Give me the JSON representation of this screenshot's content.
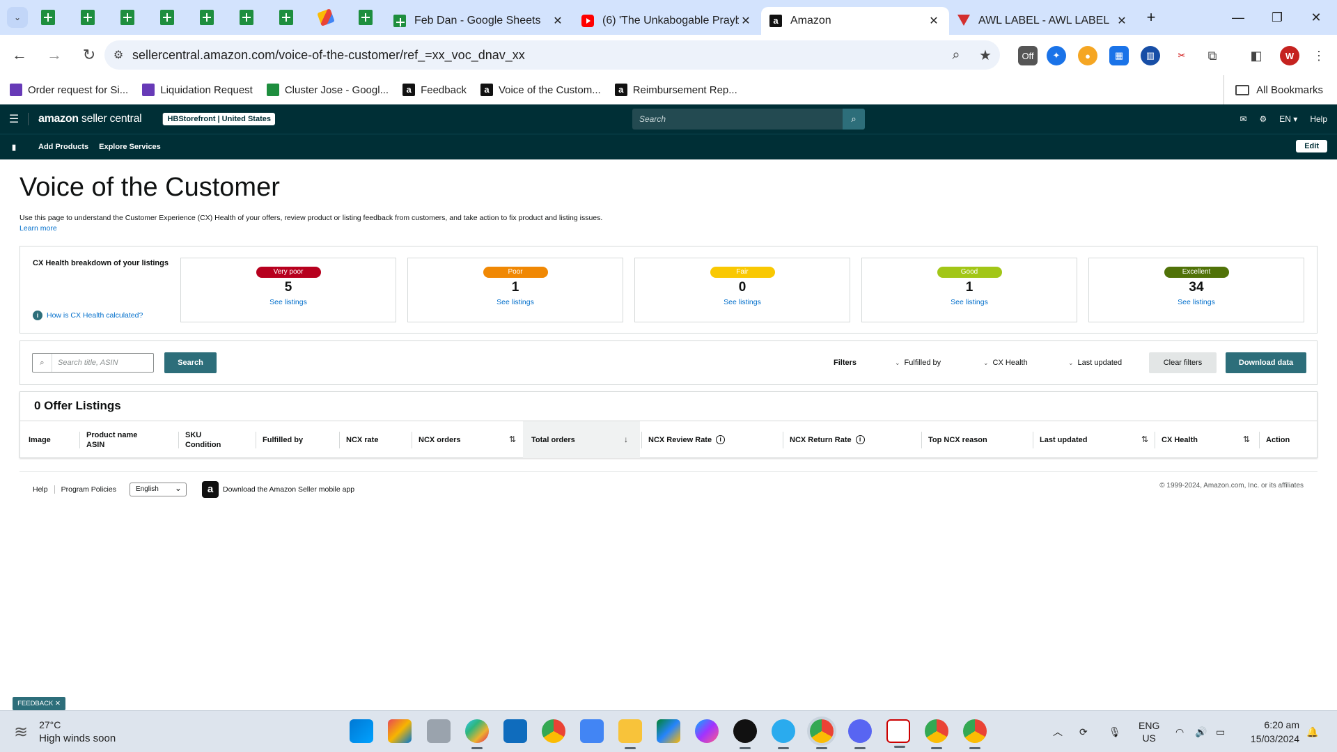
{
  "browser": {
    "tabs": [
      {
        "title": "Feb Dan - Google Sheets",
        "icon": "sheets-icon"
      },
      {
        "title": "(6) 'The Unkabogable Prayb",
        "icon": "youtube-icon"
      },
      {
        "title": "Amazon",
        "icon": "amazon-icon",
        "active": true
      },
      {
        "title": "AWL LABEL - AWL LABEL",
        "icon": "awl-icon"
      }
    ],
    "url": "sellercentral.amazon.com/voice-of-the-customer/ref_=xx_voc_dnav_xx",
    "profile_initial": "W",
    "bookmarks": [
      {
        "label": "Order request for Si...",
        "icon": "forms-icon"
      },
      {
        "label": "Liquidation Request",
        "icon": "forms-icon"
      },
      {
        "label": "Cluster Jose - Googl...",
        "icon": "sheets-icon"
      },
      {
        "label": "Feedback",
        "icon": "amazon-icon"
      },
      {
        "label": "Voice of the Custom...",
        "icon": "amazon-icon"
      },
      {
        "label": "Reimbursement Rep...",
        "icon": "amazon-icon"
      }
    ],
    "all_bookmarks": "All Bookmarks"
  },
  "seller_header": {
    "logo_strong": "amazon",
    "logo_rest": " seller central",
    "store": "HBStorefront | United States",
    "search_placeholder": "Search",
    "lang": "EN",
    "help": "Help",
    "subnav": [
      "Add Products",
      "Explore Services"
    ],
    "edit": "Edit"
  },
  "page": {
    "title": "Voice of the Customer",
    "intro": "Use this page to understand the Customer Experience (CX) Health of your offers, review product or listing feedback from customers, and take action to fix product and listing issues.",
    "learn_more": "Learn more"
  },
  "cx_health": {
    "label": "CX Health breakdown of your listings",
    "help_link": "How is CX Health calculated?",
    "see_listings": "See listings",
    "cards": [
      {
        "label": "Very poor",
        "count": "5",
        "color": "#b7001e"
      },
      {
        "label": "Poor",
        "count": "1",
        "color": "#f08804"
      },
      {
        "label": "Fair",
        "count": "0",
        "color": "#f9c802"
      },
      {
        "label": "Good",
        "count": "1",
        "color": "#a2c617"
      },
      {
        "label": "Excellent",
        "count": "34",
        "color": "#507208"
      }
    ]
  },
  "filters": {
    "search_placeholder": "Search title, ASIN",
    "search_button": "Search",
    "filters_label": "Filters",
    "dropdowns": [
      "Fulfilled by",
      "CX Health",
      "Last updated"
    ],
    "clear": "Clear filters",
    "download": "Download data"
  },
  "table": {
    "title": "0 Offer Listings",
    "columns": {
      "image": "Image",
      "product_name": "Product name",
      "asin": "ASIN",
      "sku": "SKU",
      "condition": "Condition",
      "fulfilled_by": "Fulfilled by",
      "ncx_rate": "NCX rate",
      "ncx_orders": "NCX orders",
      "total_orders": "Total orders",
      "ncx_review_rate": "NCX Review Rate",
      "ncx_return_rate": "NCX Return Rate",
      "top_ncx_reason": "Top NCX reason",
      "last_updated": "Last updated",
      "cx_health": "CX Health",
      "action": "Action"
    }
  },
  "footer": {
    "help": "Help",
    "policies": "Program Policies",
    "language": "English",
    "app": "Download the Amazon Seller mobile app",
    "copyright": "© 1999-2024, Amazon.com, Inc. or its affiliates"
  },
  "feedback_tab": "FEEDBACK ✕",
  "taskbar": {
    "temp": "27°C",
    "weather": "High winds soon",
    "lang_1": "ENG",
    "lang_2": "US",
    "time": "6:20 am",
    "date": "15/03/2024"
  }
}
